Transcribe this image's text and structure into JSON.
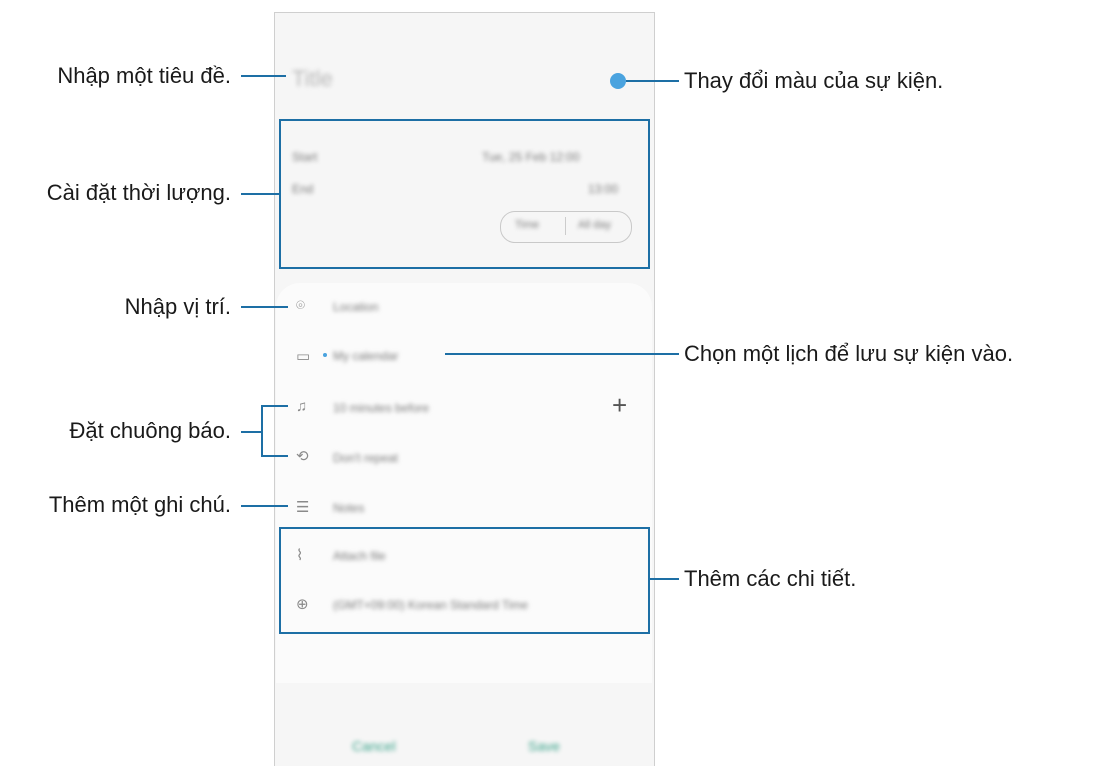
{
  "phone": {
    "title_placeholder": "Title",
    "start_label": "Start",
    "start_value": "Tue, 25 Feb   12:00",
    "end_label": "End",
    "end_value": "13:00",
    "pill_left": "Time",
    "pill_right": "All day",
    "rows": {
      "location": "Location",
      "calendar": "My calendar",
      "reminder": "10 minutes before",
      "repeat": "Don't repeat",
      "notes": "Notes",
      "attach": "Attach file",
      "timezone": "(GMT+09:00) Korean Standard Time"
    },
    "cancel": "Cancel",
    "save": "Save",
    "accent_color": "#4aa3df"
  },
  "annotations": {
    "title": "Nhập một tiêu đề.",
    "duration": "Cài đặt thời lượng.",
    "location": "Nhập vị trí.",
    "alarm": "Đặt chuông báo.",
    "note": "Thêm một ghi chú.",
    "color": "Thay đổi màu của sự kiện.",
    "calendar": "Chọn một lịch để lưu sự kiện vào.",
    "details": "Thêm các chi tiết."
  },
  "callout_color": "#1d6fa5"
}
